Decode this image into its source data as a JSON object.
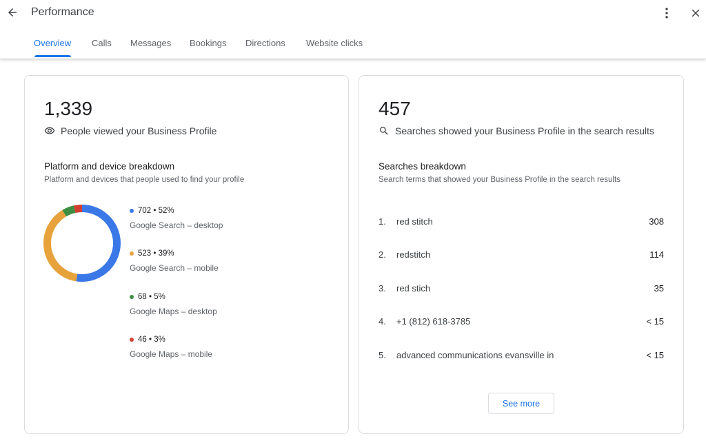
{
  "header": {
    "title": "Performance",
    "back_icon": "arrow-left-icon",
    "more_icon": "more-vert-icon",
    "close_icon": "close-icon"
  },
  "tabs": [
    {
      "label": "Overview",
      "active": true
    },
    {
      "label": "Calls",
      "active": false
    },
    {
      "label": "Messages",
      "active": false
    },
    {
      "label": "Bookings",
      "active": false
    },
    {
      "label": "Directions",
      "active": false
    },
    {
      "label": "Website clicks",
      "active": false
    }
  ],
  "views_card": {
    "total": "1,339",
    "description": "People viewed your Business Profile",
    "icon": "eye-icon",
    "section_title": "Platform and device breakdown",
    "section_subtitle": "Platform and devices that people used to find your profile"
  },
  "searches_card": {
    "total": "457",
    "description": "Searches showed your Business Profile in the search results",
    "icon": "search-icon",
    "section_title": "Searches breakdown",
    "section_subtitle": "Search terms that showed your Business Profile in the search results",
    "rows": [
      {
        "rank": "1.",
        "term": "red stitch",
        "count": "308"
      },
      {
        "rank": "2.",
        "term": "redstitch",
        "count": "114"
      },
      {
        "rank": "3.",
        "term": "red stich",
        "count": "35"
      },
      {
        "rank": "4.",
        "term": "+1 (812) 618-3785",
        "count": "< 15"
      },
      {
        "rank": "5.",
        "term": "advanced communications evansville in",
        "count": "< 15"
      }
    ],
    "see_more_label": "See more"
  },
  "chart_data": {
    "type": "pie",
    "title": "Platform and device breakdown",
    "donut": true,
    "categories": [
      "Google Search – desktop",
      "Google Search – mobile",
      "Google Maps – desktop",
      "Google Maps – mobile"
    ],
    "values": [
      702,
      523,
      68,
      46
    ],
    "percents": [
      "52%",
      "39%",
      "5%",
      "3%"
    ],
    "value_labels": [
      "702 • 52%",
      "523 • 39%",
      "68 • 5%",
      "46 • 3%"
    ],
    "colors": [
      "#3b78e7",
      "#e8a23b",
      "#3e8e41",
      "#d23f31"
    ],
    "legend": "right"
  }
}
